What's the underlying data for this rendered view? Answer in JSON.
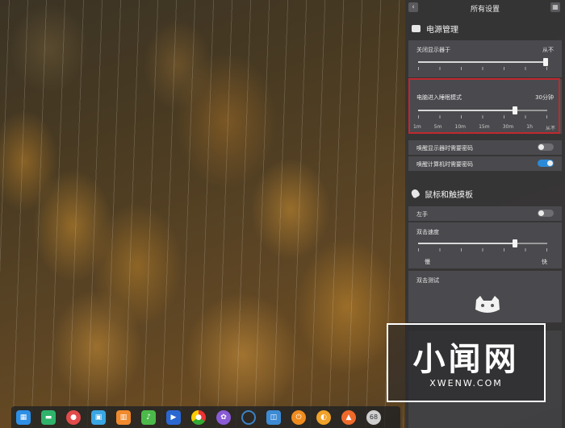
{
  "panel": {
    "title": "所有设置",
    "back_icon": "chevron-left-icon",
    "grid_icon": "grid-icon"
  },
  "power": {
    "section_title": "电源管理",
    "icon": "battery-icon",
    "display_off": {
      "label": "关闭显示器于",
      "value": "从不",
      "level": 1.0
    },
    "sleep": {
      "label": "电脑进入睡眠模式",
      "value": "30分钟",
      "level": 0.75,
      "ticks": [
        "1m",
        "5m",
        "10m",
        "15m",
        "30m",
        "1h",
        "从不"
      ]
    },
    "wake_display_password": {
      "label": "唤醒显示器时需要密码",
      "enabled": false
    },
    "wake_computer_password": {
      "label": "唤醒计算机时需要密码",
      "enabled": true
    }
  },
  "mouse": {
    "section_title": "鼠标和触摸板",
    "icon": "mouse-icon",
    "left_hand": {
      "label": "左手",
      "enabled": false
    },
    "double_click_speed": {
      "label": "双击速度",
      "level": 0.75,
      "min_label": "慢",
      "max_label": "快"
    },
    "double_click_test": {
      "label": "双击测试",
      "icon": "cat-face-icon"
    }
  },
  "dock": {
    "items": [
      {
        "name": "launcher-icon",
        "color": "#2d8fe6"
      },
      {
        "name": "file-manager-icon",
        "color": "#2fb36b"
      },
      {
        "name": "screen-record-icon",
        "color": "#e24b4b"
      },
      {
        "name": "app-store-icon",
        "color": "#3aa6e3"
      },
      {
        "name": "archive-manager-icon",
        "color": "#f08a2d"
      },
      {
        "name": "music-icon",
        "color": "#4cba4a"
      },
      {
        "name": "movie-icon",
        "color": "#2b67d1"
      },
      {
        "name": "chrome-icon",
        "color": "#dfb529"
      },
      {
        "name": "settings-icon",
        "color": "#8a5bd6"
      },
      {
        "name": "loading-icon",
        "color": "#3b82c4"
      },
      {
        "name": "system-monitor-icon",
        "color": "#3d8bd5"
      },
      {
        "name": "power-icon",
        "color": "#f08c1e"
      },
      {
        "name": "browser-icon",
        "color": "#f0a22a"
      },
      {
        "name": "downloader-icon",
        "color": "#ef6a2a"
      },
      {
        "name": "trash-icon",
        "color": "#cfcfcf"
      }
    ],
    "trash_badge": "68"
  },
  "watermark": {
    "logo": "小闻网",
    "url": "XWENW.COM"
  }
}
